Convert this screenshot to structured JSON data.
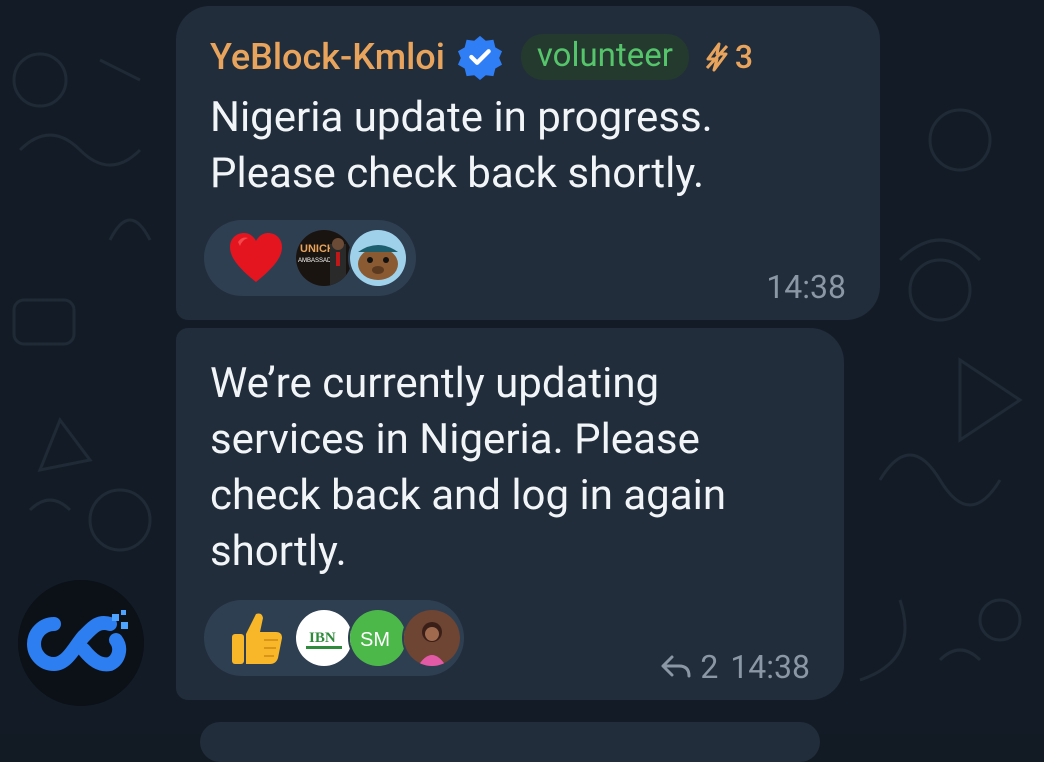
{
  "messages": [
    {
      "sender": "YeBlock-Kmloi",
      "badge": "volunteer",
      "boost_count": "3",
      "text": "Nigeria update in progress.\nPlease check back shortly.",
      "reaction_emoji": "heart",
      "avatar_label": "UNICH AMBASSADOR",
      "time": "14:38"
    },
    {
      "text": "We’re currently updating\nservices in Nigeria. Please\ncheck back and log in again\nshortly.",
      "reaction_emoji": "thumbs-up",
      "avatar_label_1": "IBN",
      "avatar_label_2": "SM",
      "reply_count": "2",
      "time": "14:38"
    }
  ],
  "colors": {
    "background": "#131c26",
    "bubble": "#212d3b",
    "sender": "#e8a45c",
    "badge_text": "#55c46b",
    "meta": "#8b97a5",
    "verified": "#2f7ef5"
  }
}
